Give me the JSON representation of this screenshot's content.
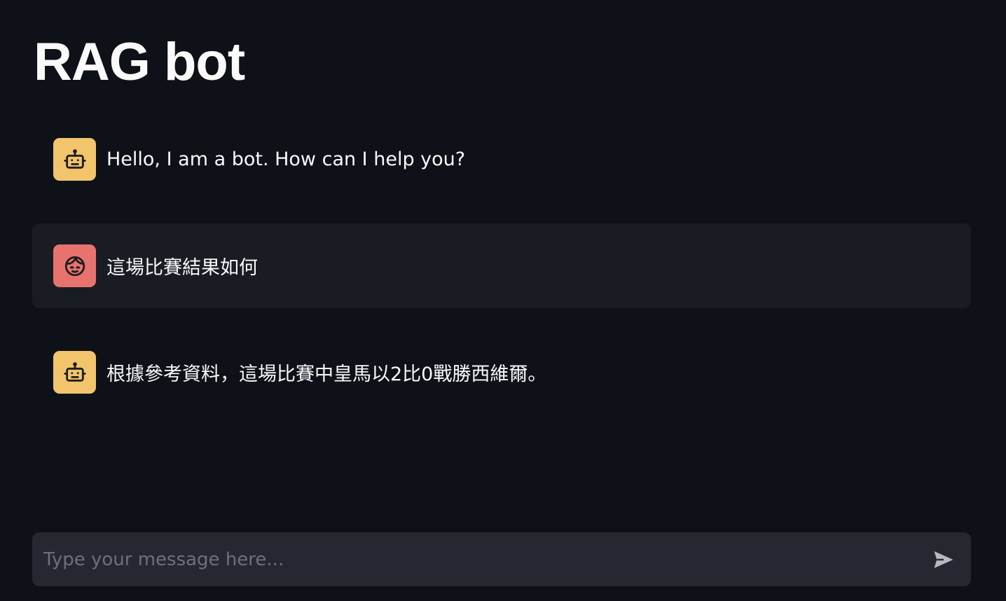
{
  "header": {
    "title": "RAG bot"
  },
  "messages": [
    {
      "role": "assistant",
      "avatar_icon": "robot-icon",
      "avatar_color": "#f2c46c",
      "text": "Hello, I am a bot. How can I help you?"
    },
    {
      "role": "user",
      "avatar_icon": "face-icon",
      "avatar_color": "#e8736e",
      "text": "這場比賽結果如何"
    },
    {
      "role": "assistant",
      "avatar_icon": "robot-icon",
      "avatar_color": "#f2c46c",
      "text": "根據參考資料，這場比賽中皇馬以2比0戰勝西維爾。"
    }
  ],
  "chat_input": {
    "placeholder": "Type your message here...",
    "value": "",
    "send_icon": "send-icon"
  },
  "colors": {
    "background": "#0e1117",
    "user_message_bg": "#1a1c24",
    "input_bg": "#262730",
    "text": "#fafafa",
    "placeholder": "#6e7079"
  }
}
